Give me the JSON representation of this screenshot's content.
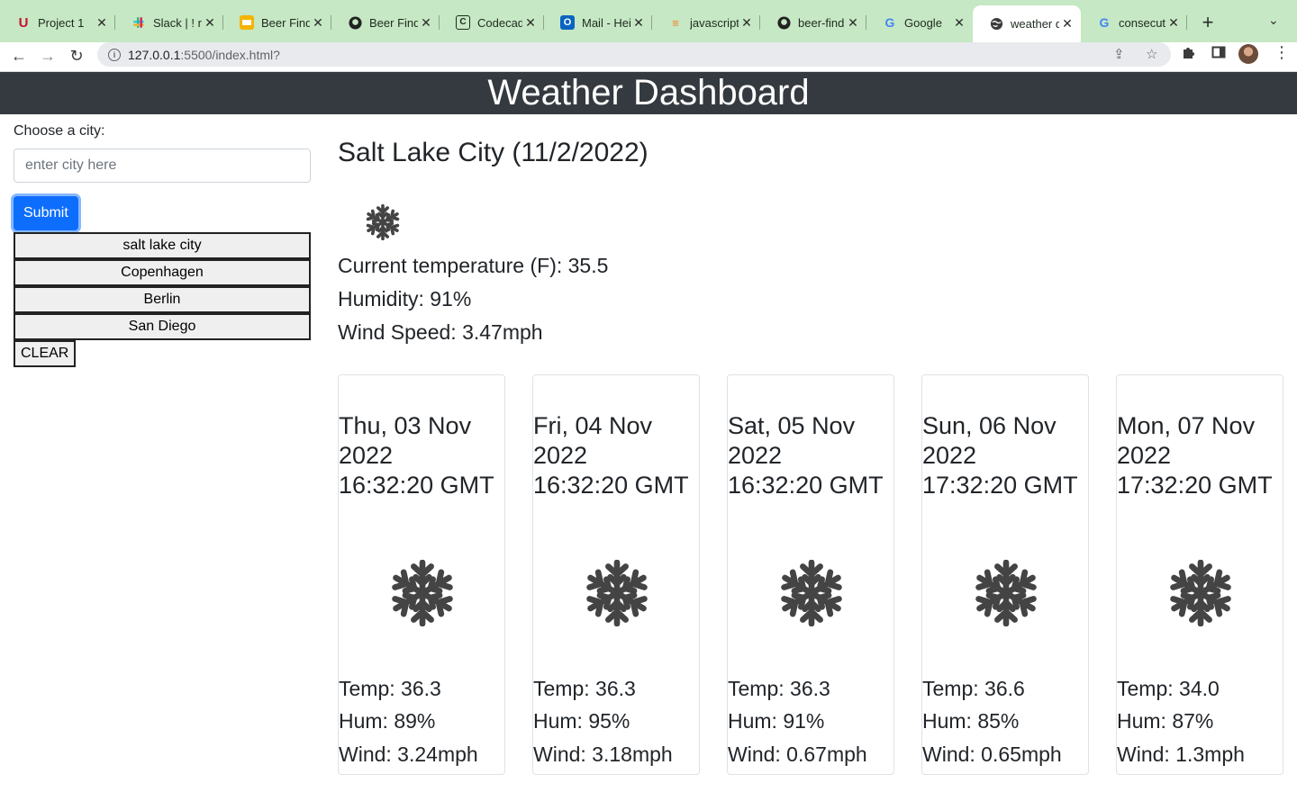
{
  "browser": {
    "tabs": [
      {
        "title": "Project 1",
        "icon": "u-logo-icon"
      },
      {
        "title": "Slack | ! r",
        "icon": "slack-icon"
      },
      {
        "title": "Beer Find",
        "icon": "slides-icon"
      },
      {
        "title": "Beer Find",
        "icon": "github-icon"
      },
      {
        "title": "Codecade",
        "icon": "codecademy-icon"
      },
      {
        "title": "Mail - Hei",
        "icon": "outlook-icon"
      },
      {
        "title": "javascript",
        "icon": "stackoverflow-icon"
      },
      {
        "title": "beer-find",
        "icon": "github-icon"
      },
      {
        "title": "Google",
        "icon": "google-icon"
      },
      {
        "title": "weather d",
        "icon": "globe-icon",
        "active": true
      },
      {
        "title": "consecuti",
        "icon": "google-icon"
      }
    ],
    "url_host": "127.0.0.1",
    "url_rest": ":5500/index.html?"
  },
  "header": {
    "title": "Weather Dashboard"
  },
  "search": {
    "label": "Choose a city:",
    "placeholder": "enter city here",
    "submit_label": "Submit",
    "history": [
      "salt lake city",
      "Copenhagen",
      "Berlin",
      "San Diego"
    ],
    "clear_label": "CLEAR"
  },
  "current": {
    "title": "Salt Lake City (11/2/2022)",
    "icon": "snowflake-icon",
    "temp": "Current temperature (F): 35.5",
    "humidity": "Humidity: 91%",
    "wind": "Wind Speed: 3.47mph"
  },
  "forecast": [
    {
      "date_line1": "Thu, 03 Nov",
      "date_line2": "2022",
      "date_line3": "16:32:20 GMT",
      "temp": "Temp: 36.3",
      "hum": "Hum: 89%",
      "wind": "Wind: 3.24mph"
    },
    {
      "date_line1": "Fri, 04 Nov",
      "date_line2": "2022",
      "date_line3": "16:32:20 GMT",
      "temp": "Temp: 36.3",
      "hum": "Hum: 95%",
      "wind": "Wind: 3.18mph"
    },
    {
      "date_line1": "Sat, 05 Nov",
      "date_line2": "2022",
      "date_line3": "16:32:20 GMT",
      "temp": "Temp: 36.3",
      "hum": "Hum: 91%",
      "wind": "Wind: 0.67mph"
    },
    {
      "date_line1": "Sun, 06 Nov",
      "date_line2": "2022",
      "date_line3": "17:32:20 GMT",
      "temp": "Temp: 36.6",
      "hum": "Hum: 85%",
      "wind": "Wind: 0.65mph"
    },
    {
      "date_line1": "Mon, 07 Nov",
      "date_line2": "2022",
      "date_line3": "17:32:20 GMT",
      "temp": "Temp: 34.0",
      "hum": "Hum: 87%",
      "wind": "Wind: 1.3mph"
    }
  ],
  "colors": {
    "header_bg": "#343a40",
    "tabbar_bg": "#c6e8c4",
    "primary": "#0d6efd",
    "icon": "#444444"
  }
}
